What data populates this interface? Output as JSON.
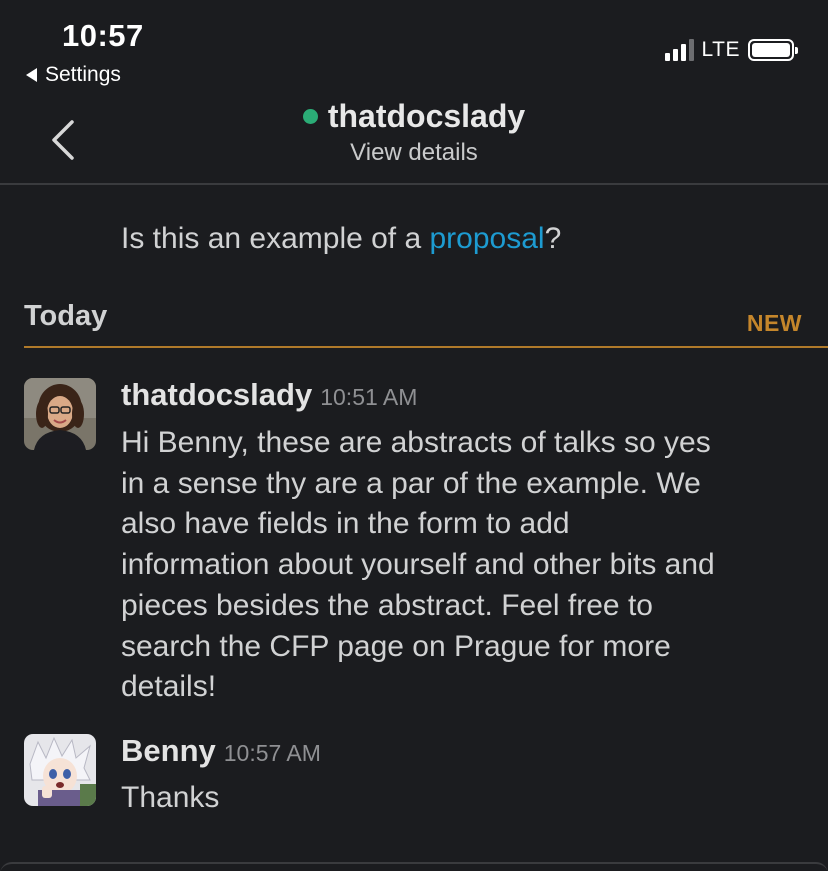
{
  "status_bar": {
    "time": "10:57",
    "back_app": "Settings",
    "network": "LTE",
    "signal_bars_active": 3,
    "signal_bars_total": 4,
    "battery_level": 1.0
  },
  "header": {
    "channel_name": "thatdocslady",
    "subtitle": "View details",
    "presence_color": "#2bac76"
  },
  "earlier_message": {
    "text_before": "Is this an example of a ",
    "link_text": "proposal",
    "text_after": "?"
  },
  "day_divider": {
    "label": "Today",
    "new_label": "NEW"
  },
  "messages": [
    {
      "author": "thatdocslady",
      "time": "10:51 AM",
      "lines": [
        "Hi Benny, these are abstracts of talks so yes",
        "in a sense thy are a par of the example. We",
        "also have fields in the form to add",
        "information about yourself and other bits and",
        "pieces besides the abstract. Feel free to",
        "search the CFP page on Prague for more",
        "details!"
      ]
    },
    {
      "author": "Benny",
      "time": "10:57 AM",
      "lines": [
        "Thanks"
      ]
    }
  ],
  "colors": {
    "background": "#1b1c1f",
    "link": "#1d9bd1",
    "new_accent": "#c5862b",
    "presence": "#2bac76"
  }
}
